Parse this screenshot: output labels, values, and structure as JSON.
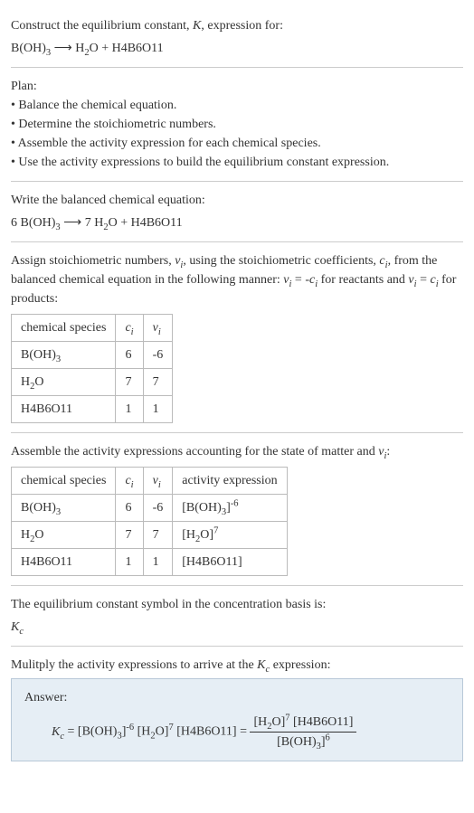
{
  "intro": {
    "line1": "Construct the equilibrium constant, K, expression for:",
    "equation": "B(OH)₃ ⟶ H₂O + H4B6O11"
  },
  "plan": {
    "heading": "Plan:",
    "items": [
      "Balance the chemical equation.",
      "Determine the stoichiometric numbers.",
      "Assemble the activity expression for each chemical species.",
      "Use the activity expressions to build the equilibrium constant expression."
    ]
  },
  "balanced": {
    "heading": "Write the balanced chemical equation:",
    "equation": "6 B(OH)₃ ⟶ 7 H₂O + H4B6O11"
  },
  "stoich": {
    "heading_a": "Assign stoichiometric numbers, νᵢ, using the stoichiometric coefficients, cᵢ, from the balanced chemical equation in the following manner: νᵢ = -cᵢ for reactants and νᵢ = cᵢ for products:",
    "th1": "chemical species",
    "th2": "cᵢ",
    "th3": "νᵢ",
    "rows": [
      {
        "sp": "B(OH)₃",
        "c": "6",
        "v": "-6"
      },
      {
        "sp": "H₂O",
        "c": "7",
        "v": "7"
      },
      {
        "sp": "H4B6O11",
        "c": "1",
        "v": "1"
      }
    ]
  },
  "activity": {
    "heading": "Assemble the activity expressions accounting for the state of matter and νᵢ:",
    "th1": "chemical species",
    "th2": "cᵢ",
    "th3": "νᵢ",
    "th4": "activity expression",
    "rows": [
      {
        "sp": "B(OH)₃",
        "c": "6",
        "v": "-6",
        "a": "[B(OH)₃]⁻⁶"
      },
      {
        "sp": "H₂O",
        "c": "7",
        "v": "7",
        "a": "[H₂O]⁷"
      },
      {
        "sp": "H4B6O11",
        "c": "1",
        "v": "1",
        "a": "[H4B6O11]"
      }
    ]
  },
  "symbol": {
    "heading": "The equilibrium constant symbol in the concentration basis is:",
    "value": "K_c"
  },
  "final": {
    "heading": "Mulitply the activity expressions to arrive at the K_c expression:",
    "answer_label": "Answer:",
    "kc": "K_c",
    "eq": "= [B(OH)₃]⁻⁶ [H₂O]⁷ [H4B6O11] =",
    "num": "[H₂O]⁷ [H4B6O11]",
    "den": "[B(OH)₃]⁶"
  }
}
